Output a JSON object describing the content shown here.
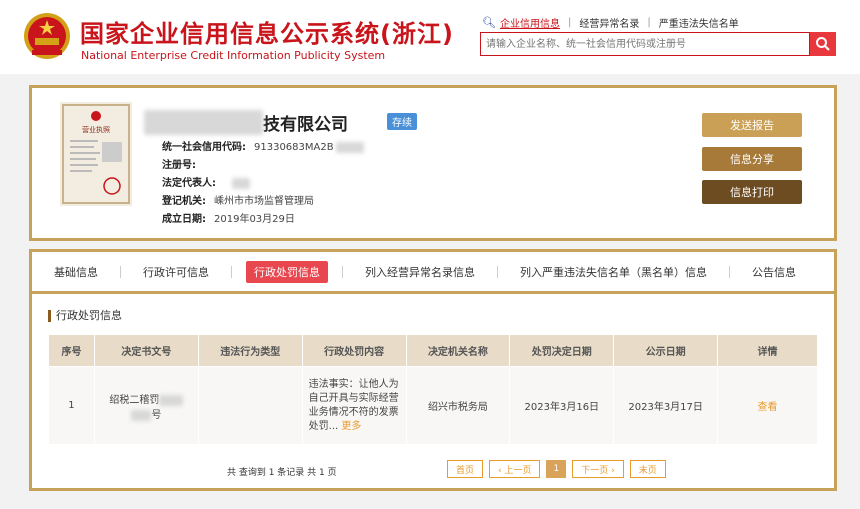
{
  "header": {
    "title": "国家企业信用信息公示系统",
    "region": "(浙江)",
    "subtitle": "National Enterprise Credit Information Publicity System",
    "links": [
      "企业信用信息",
      "经营异常名录",
      "严重违法失信名单"
    ],
    "search_placeholder": "请输入企业名称、统一社会信用代码或注册号"
  },
  "company": {
    "name_suffix": "技有限公司",
    "status": "存续",
    "fields": [
      {
        "label": "统一社会信用代码:",
        "value": "91330683MA2B"
      },
      {
        "label": "注册号:",
        "value": ""
      },
      {
        "label": "法定代表人:",
        "value": ""
      },
      {
        "label": "登记机关:",
        "value": "嵊州市市场监督管理局"
      },
      {
        "label": "成立日期:",
        "value": "2019年03月29日"
      }
    ],
    "license_title": "营业执照",
    "buttons": [
      "发送报告",
      "信息分享",
      "信息打印"
    ]
  },
  "tabs": [
    "基础信息",
    "行政许可信息",
    "行政处罚信息",
    "列入经营异常名录信息",
    "列入严重违法失信名单（黑名单）信息",
    "公告信息"
  ],
  "active_tab": 2,
  "section_title": "行政处罚信息",
  "table": {
    "headers": [
      "序号",
      "决定书文号",
      "违法行为类型",
      "行政处罚内容",
      "决定机关名称",
      "处罚决定日期",
      "公示日期",
      "详情"
    ],
    "rows": [
      {
        "index": "1",
        "doc_no": "绍税二稽罚",
        "doc_no_tail": "号",
        "type": "",
        "content": "违法事实：让他人为自己开具与实际经营业务情况不符的发票 处罚...",
        "more": "更多",
        "authority": "绍兴市税务局",
        "decision_date": "2023年3月16日",
        "publish_date": "2023年3月17日",
        "detail": "查看"
      }
    ]
  },
  "footer": {
    "count_text": "共 查询到 1 条记录 共 1 页",
    "pager": [
      "首页",
      "‹ 上一页",
      "1",
      "下一页 ›",
      "末页"
    ]
  },
  "colors": {
    "brand_red": "#c8141a",
    "gold": "#c7a25a",
    "badge_blue": "#4a90d9"
  }
}
